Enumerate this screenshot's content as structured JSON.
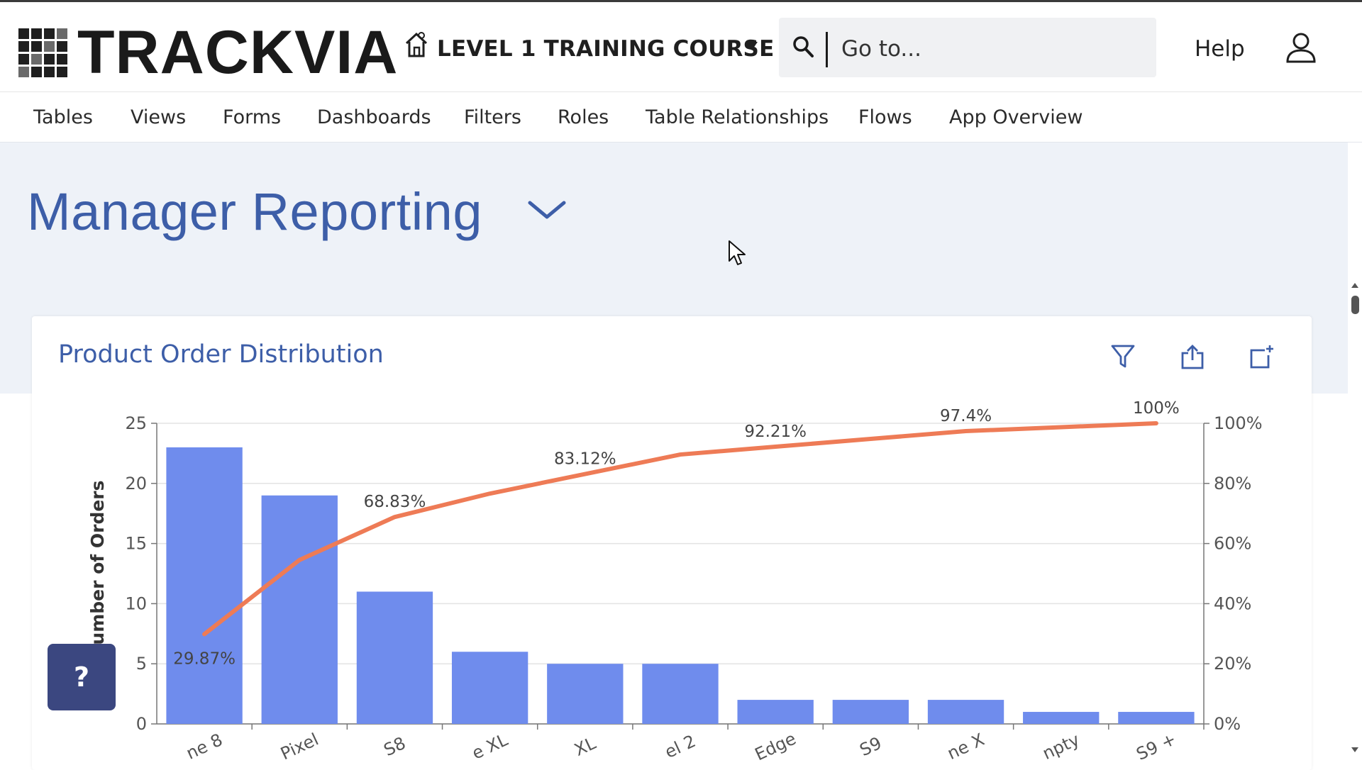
{
  "header": {
    "logo_text": "TRACKVIA",
    "app_name": "LEVEL 1 TRAINING COURSE",
    "search": {
      "placeholder": "Go to..."
    },
    "help_label": "Help"
  },
  "nav": {
    "items": [
      {
        "label": "Tables"
      },
      {
        "label": "Views"
      },
      {
        "label": "Forms"
      },
      {
        "label": "Dashboards"
      },
      {
        "label": "Filters"
      },
      {
        "label": "Roles"
      },
      {
        "label": "Table Relationships"
      },
      {
        "label": "Flows"
      },
      {
        "label": "App Overview"
      }
    ]
  },
  "page": {
    "title": "Manager Reporting"
  },
  "card": {
    "title": "Product Order Distribution"
  },
  "help_fab": {
    "label": "?"
  },
  "colors": {
    "accent": "#3d5ea8",
    "bar": "#6f8ced",
    "line": "#ee7b56",
    "fab": "#3b4780"
  },
  "chart_data": {
    "type": "bar",
    "ylabel": "Number of Orders",
    "ylim": [
      0,
      25
    ],
    "y_ticks": [
      "0",
      "5",
      "10",
      "15",
      "20",
      "25"
    ],
    "y2lim": [
      0,
      100
    ],
    "y2_ticks": [
      "0%",
      "20%",
      "40%",
      "60%",
      "80%",
      "100%"
    ],
    "categories": [
      "ne 8",
      "Pixel",
      "S8",
      "e XL",
      "XL",
      "el 2",
      "Edge",
      "S9",
      "ne X",
      "npty",
      "S9 +"
    ],
    "values": [
      23,
      19,
      11,
      6,
      5,
      5,
      2,
      2,
      2,
      1,
      1
    ],
    "cumulative_percent": [
      29.87,
      54.55,
      68.83,
      76.62,
      83.12,
      89.61,
      92.21,
      94.81,
      97.4,
      98.7,
      100
    ],
    "data_labels": [
      {
        "index": 0,
        "text": "29.87%"
      },
      {
        "index": 2,
        "text": "68.83%"
      },
      {
        "index": 4,
        "text": "83.12%"
      },
      {
        "index": 6,
        "text": "92.21%"
      },
      {
        "index": 8,
        "text": "97.4%"
      },
      {
        "index": 10,
        "text": "100%"
      }
    ],
    "grid": true
  }
}
